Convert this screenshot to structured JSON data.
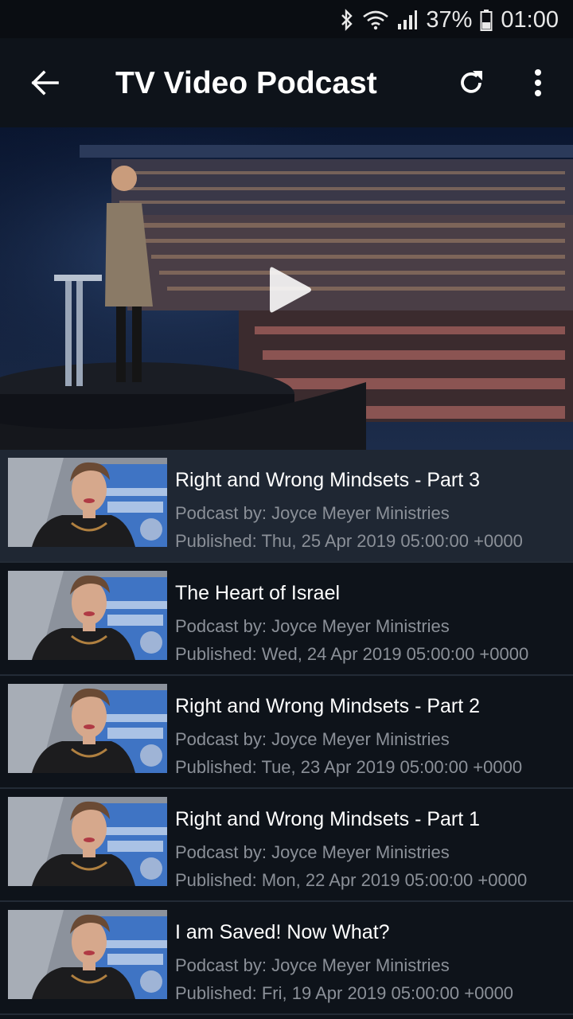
{
  "status_bar": {
    "battery": "37%",
    "time": "01:00",
    "icons": [
      "bluetooth-icon",
      "wifi-icon",
      "signal-icon",
      "battery-icon"
    ]
  },
  "app_bar": {
    "title": "TV Video Podcast",
    "icons": [
      "back-arrow-icon",
      "refresh-icon",
      "more-vert-icon"
    ]
  },
  "hero": {
    "play_icon": "play-icon"
  },
  "episodes": [
    {
      "title": "Right and Wrong Mindsets - Part 3",
      "author": "Podcast by: Joyce Meyer Ministries",
      "published": "Published: Thu, 25 Apr 2019 05:00:00 +0000",
      "selected": true
    },
    {
      "title": "The Heart of Israel",
      "author": "Podcast by: Joyce Meyer Ministries",
      "published": "Published: Wed, 24 Apr 2019 05:00:00 +0000"
    },
    {
      "title": "Right and Wrong Mindsets - Part 2",
      "author": "Podcast by: Joyce Meyer Ministries",
      "published": "Published: Tue, 23 Apr 2019 05:00:00 +0000"
    },
    {
      "title": "Right and Wrong Mindsets - Part 1",
      "author": "Podcast by: Joyce Meyer Ministries",
      "published": "Published: Mon, 22 Apr 2019 05:00:00 +0000"
    },
    {
      "title": "I am Saved! Now What?",
      "author": "Podcast by: Joyce Meyer Ministries",
      "published": "Published: Fri, 19 Apr 2019 05:00:00 +0000"
    }
  ],
  "colors": {
    "background": "#0e131a",
    "selected_row": "#1f2733",
    "secondary_text": "#8b9098"
  }
}
